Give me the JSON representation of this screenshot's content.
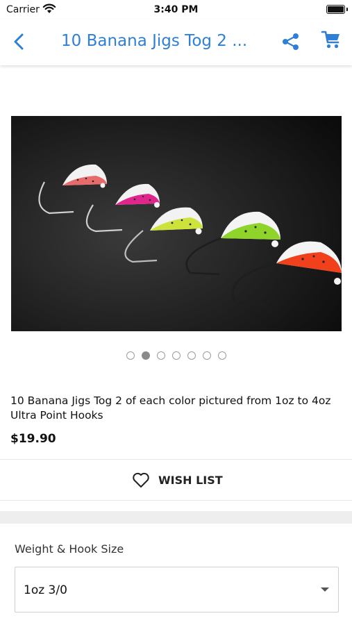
{
  "status_bar": {
    "carrier": "Carrier",
    "time": "3:40 PM",
    "icons": [
      "wifi-icon",
      "battery-icon"
    ]
  },
  "nav": {
    "title": "10 Banana Jigs Tog 2 ...",
    "accent_color": "#2f7fd6",
    "icons": [
      "chevron-left-icon",
      "share-icon",
      "cart-icon"
    ]
  },
  "product": {
    "image_count": 7,
    "active_image_index": 1,
    "title": "10 Banana Jigs Tog 2 of each color pictured from 1oz to 4oz Ultra Point Hooks",
    "price": "$19.90"
  },
  "wishlist": {
    "label": "WISH LIST",
    "icon": "heart-outline-icon"
  },
  "option": {
    "label": "Weight & Hook Size",
    "selected_value": "1oz 3/0",
    "icon": "caret-down-icon"
  }
}
